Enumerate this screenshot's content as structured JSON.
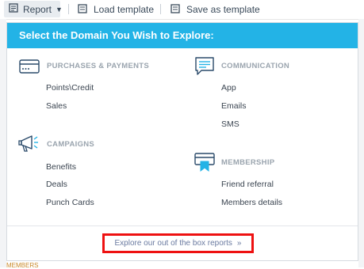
{
  "toolbar": {
    "report_label": "Report",
    "load_label": "Load template",
    "save_label": "Save as template"
  },
  "modal": {
    "title": "Select the Domain You Wish to Explore:",
    "sections": {
      "purchases": {
        "title": "PURCHASES & PAYMENTS",
        "items": [
          "Points\\Credit",
          "Sales"
        ]
      },
      "communication": {
        "title": "COMMUNICATION",
        "items": [
          "App",
          "Emails",
          "SMS"
        ]
      },
      "campaigns": {
        "title": "CAMPAIGNS",
        "items": [
          "Benefits",
          "Deals",
          "Punch Cards"
        ]
      },
      "membership": {
        "title": "MEMBERSHIP",
        "items": [
          "Friend referral",
          "Members details"
        ]
      }
    },
    "footer_link": "Explore our out of the box reports",
    "footer_chevron": "»"
  },
  "background": {
    "bottom_text": "MEMBERS"
  },
  "colors": {
    "header": "#23b3e6",
    "highlight_box": "#ee1111",
    "icon": "#2a4a6a",
    "ribbon": "#23b3e6"
  }
}
